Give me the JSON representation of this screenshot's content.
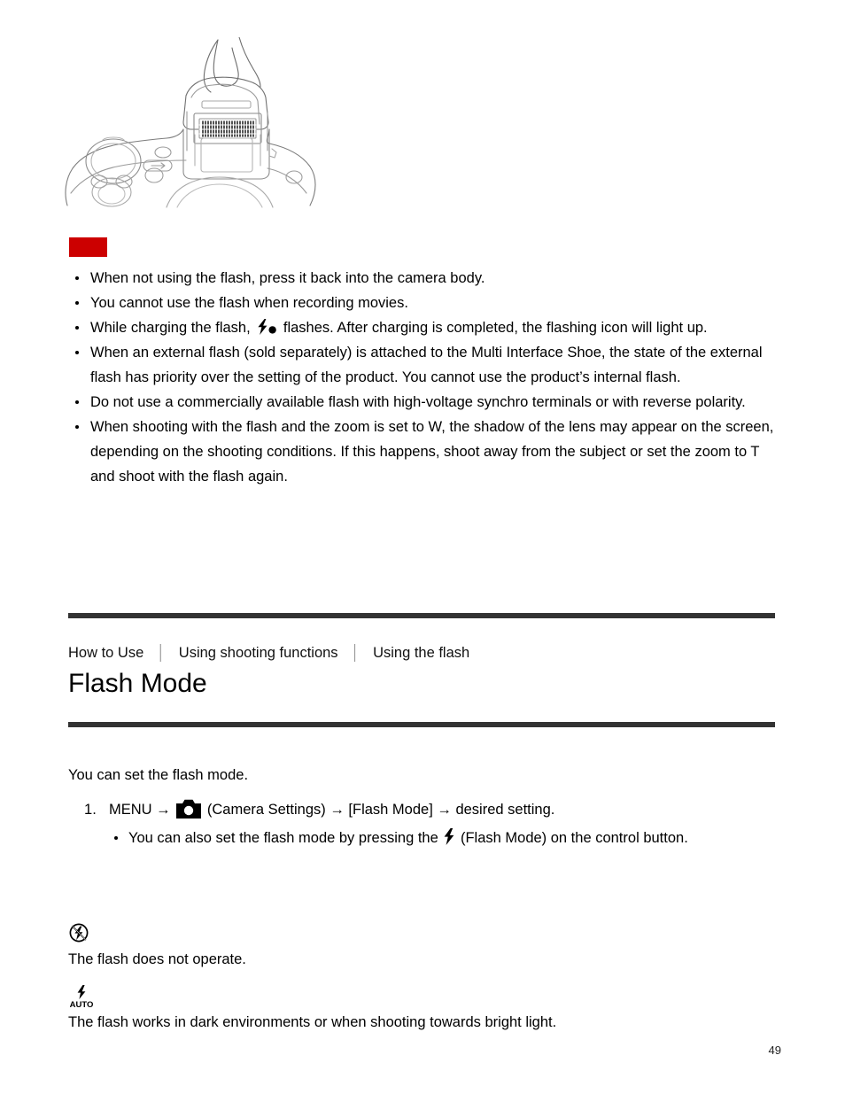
{
  "illustration": {
    "alt_name": "camera-top-flash-popup-illustration"
  },
  "note": {
    "marker_label": "",
    "bullets": [
      "When not using the flash, press it back into the camera body.",
      "You cannot use the flash when recording movies.",
      "While charging the flash, @BOLTDOT@ flashes. After charging is completed, the flashing icon will light up.",
      "When an external flash (sold separately) is attached to the Multi Interface Shoe, the state of the external flash has priority over the setting of the product. You cannot use the product’s internal flash.",
      "Do not use a commercially available flash with high-voltage synchro terminals or with reverse polarity.",
      "When shooting with the flash and the zoom is set to W, the shadow of the lens may appear on the screen, depending on the shooting conditions. If this happens, shoot away from the subject or set the zoom to T and shoot with the flash again."
    ],
    "bullet_3_pre": "While charging the flash,",
    "bullet_3_post": "flashes. After charging is completed, the flashing icon will light up."
  },
  "breadcrumb": {
    "items": [
      "How to Use",
      "Using shooting functions",
      "Using the flash"
    ],
    "separator": "│"
  },
  "header": {
    "title": "Flash Mode"
  },
  "body": {
    "intro": "You can set the flash mode.",
    "step1_pre": "MENU →",
    "step1_post": "(Camera Settings) → [Flash Mode] → desired setting.",
    "substep1_pre": "You can also set the flash mode by pressing the",
    "substep1_post": "(Flash Mode) on the control button."
  },
  "modes": [
    {
      "icon_name": "flash-off-icon",
      "icon_label": "",
      "description": "The flash does not operate."
    },
    {
      "icon_name": "flash-auto-icon",
      "icon_label": "AUTO",
      "description": "The flash works in dark environments or when shooting towards bright light."
    }
  ],
  "footer": {
    "page_number": "49"
  },
  "colors": {
    "note_marker": "#cc0000",
    "rule": "#333333",
    "text": "#000000"
  }
}
